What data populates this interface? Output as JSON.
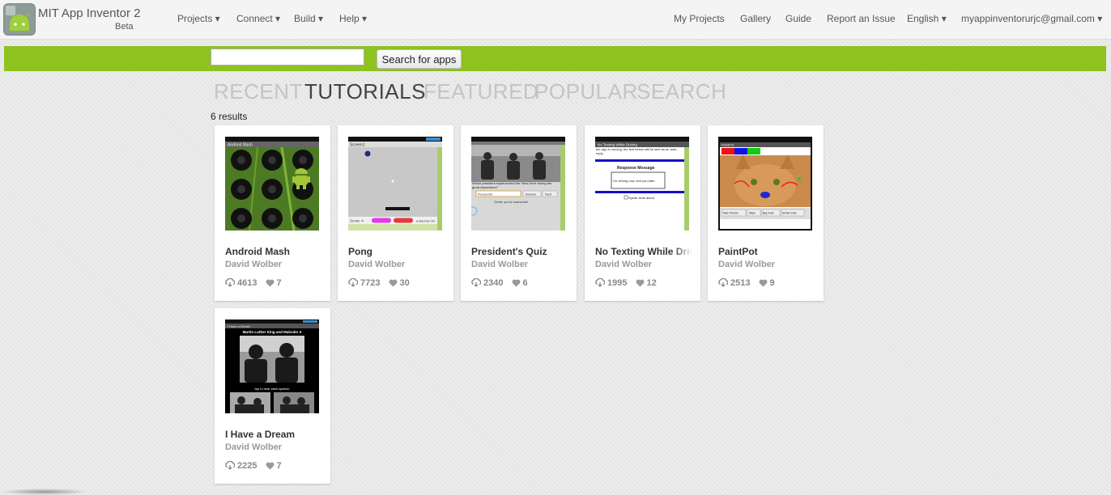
{
  "header": {
    "brand": "MIT App Inventor 2",
    "beta": "Beta",
    "menus": [
      "Projects ▾",
      "Connect ▾",
      "Build ▾",
      "Help ▾"
    ],
    "right_links": [
      "My Projects",
      "Gallery",
      "Guide",
      "Report an Issue",
      "English ▾",
      "myappinventorurjc@gmail.com ▾"
    ]
  },
  "search": {
    "value": "",
    "button_label": "Search for apps"
  },
  "tabs": [
    "RECENT",
    "TUTORIALS",
    "FEATURED",
    "POPULAR",
    "SEARCH"
  ],
  "active_tab": "TUTORIALS",
  "results_label": "6 results",
  "apps": [
    {
      "title": "Android Mash",
      "author": "David Wolber",
      "downloads": "4613",
      "likes": "7"
    },
    {
      "title": "Pong",
      "author": "David Wolber",
      "downloads": "7723",
      "likes": "30"
    },
    {
      "title": "President's Quiz",
      "author": "David Wolber",
      "downloads": "2340",
      "likes": "6"
    },
    {
      "title": "No Texting While Driving",
      "author": "David Wolber",
      "downloads": "1995",
      "likes": "12"
    },
    {
      "title": "PaintPot",
      "author": "David Wolber",
      "downloads": "2513",
      "likes": "9"
    },
    {
      "title": "I Have a Dream",
      "author": "David Wolber",
      "downloads": "2225",
      "likes": "7"
    }
  ],
  "thumb_text": {
    "mash_bar": "Android Mash",
    "pong_bar": "Screen1",
    "pong_score": "Score: 4",
    "pong_btn": "a Bounce On",
    "quiz_question": "Which president implemented the 'New Deal' during the great depression?",
    "quiz_answer": "Roosevelt",
    "quiz_answer_btn": "Answer",
    "quiz_next_btn": "Next",
    "quiz_feedback": "Great, you're awesome!",
    "notext_bar": "No Texting While Driving",
    "notext_info": "the app is running, the text below will be sent as an auto-reply",
    "notext_heading": "Response Message",
    "notext_message": "I'm driving now, text you later",
    "notext_check": "Speak texts aloud",
    "paint_bar": "PaintPot",
    "paint_btns": [
      "Take Picture",
      "Wipe",
      "Big Dots",
      "Small Dots"
    ],
    "dream_bar": "I Have a Dream",
    "dream_title": "Martin Luther King and Malcolm X",
    "dream_caption": "tap to hear each speech"
  }
}
